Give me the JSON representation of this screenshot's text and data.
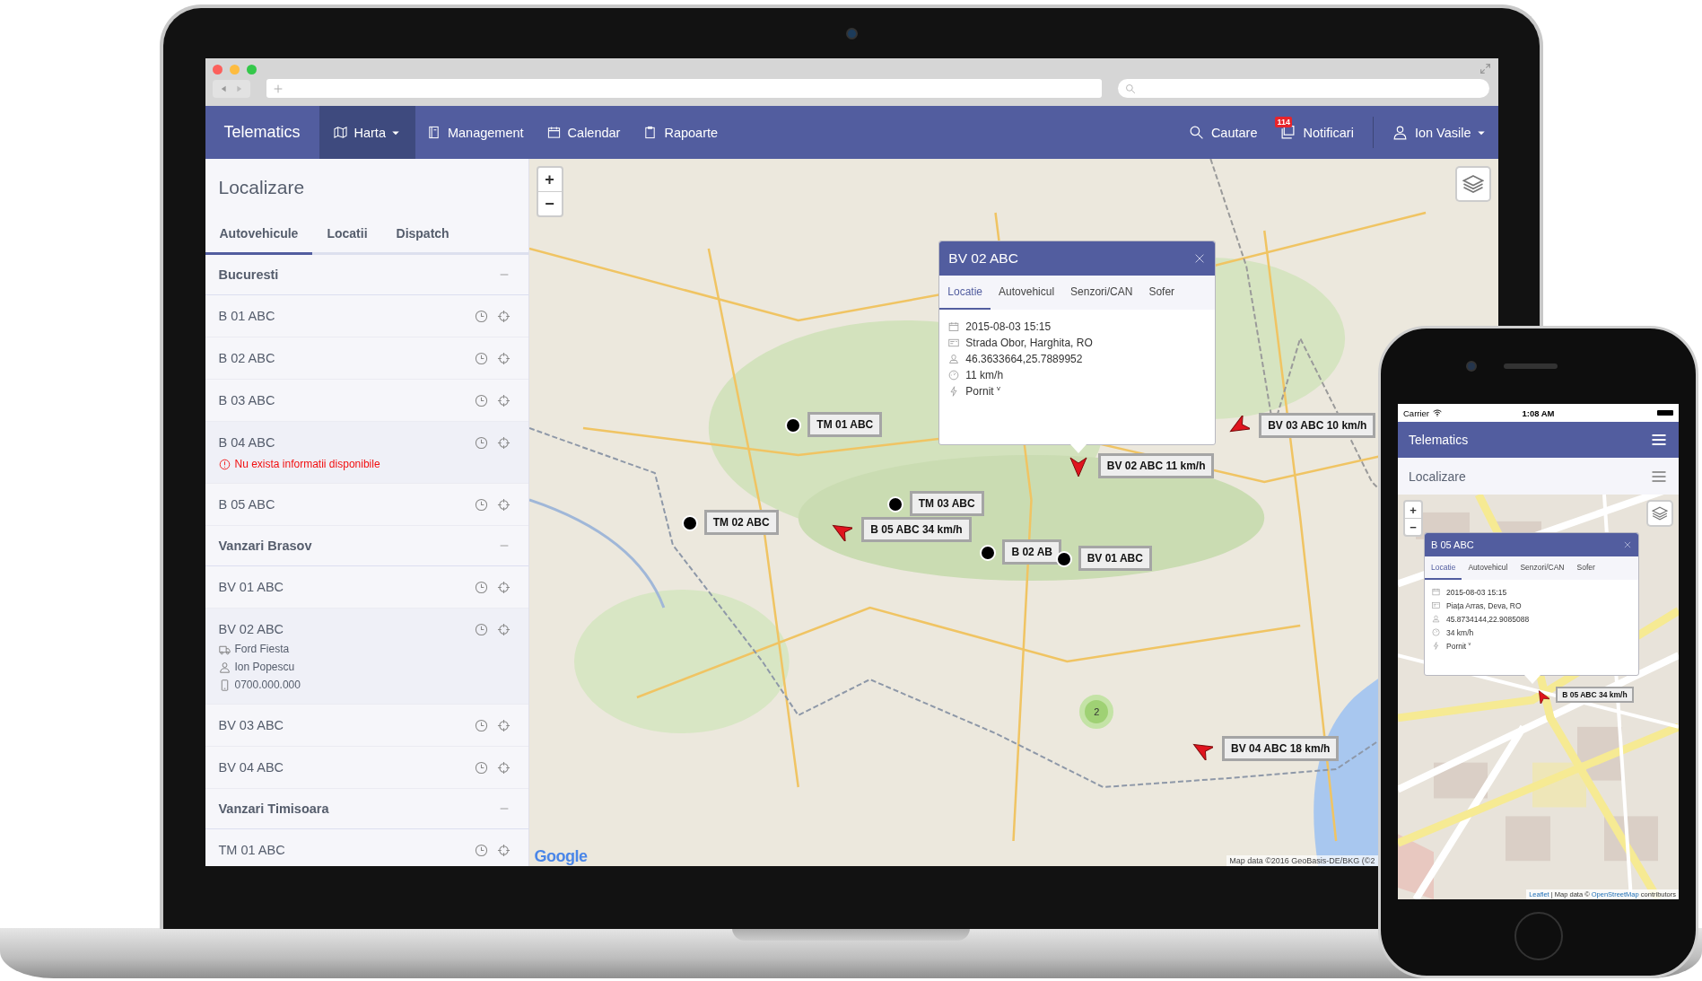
{
  "navbar": {
    "brand": "Telematics",
    "items": [
      {
        "label": "Harta",
        "dropdown": true,
        "selected": true
      },
      {
        "label": "Management",
        "dropdown": false,
        "selected": false
      },
      {
        "label": "Calendar",
        "dropdown": false,
        "selected": false
      },
      {
        "label": "Rapoarte",
        "dropdown": false,
        "selected": false
      }
    ],
    "right": [
      {
        "kind": "search",
        "label": "Cautare"
      },
      {
        "kind": "notifications",
        "label": "Notificari",
        "badge": "114"
      },
      {
        "kind": "user",
        "label": "Ion Vasile",
        "dropdown": true
      }
    ]
  },
  "sidebar": {
    "title": "Localizare",
    "tabs": [
      {
        "label": "Autovehicule",
        "selected": true
      },
      {
        "label": "Locatii",
        "selected": false
      },
      {
        "label": "Dispatch",
        "selected": false
      }
    ],
    "groups": [
      {
        "name": "Bucuresti",
        "expanded": true,
        "items": [
          {
            "plate": "B 01 ABC",
            "expanded": false
          },
          {
            "plate": "B 02 ABC",
            "expanded": false
          },
          {
            "plate": "B 03 ABC",
            "expanded": false
          },
          {
            "plate": "B 04 ABC",
            "expanded": true,
            "error": "Nu exista informatii disponibile"
          },
          {
            "plate": "B 05 ABC",
            "expanded": false
          }
        ]
      },
      {
        "name": "Vanzari Brasov",
        "expanded": true,
        "items": [
          {
            "plate": "BV 01 ABC",
            "expanded": false
          },
          {
            "plate": "BV 02 ABC",
            "expanded": true,
            "details": [
              {
                "kind": "vehicle",
                "text": "Ford Fiesta"
              },
              {
                "kind": "driver",
                "text": "Ion Popescu"
              },
              {
                "kind": "phone",
                "text": "0700.000.000"
              }
            ]
          },
          {
            "plate": "BV 03 ABC",
            "expanded": false
          },
          {
            "plate": "BV 04 ABC",
            "expanded": false
          }
        ]
      },
      {
        "name": "Vanzari Timisoara",
        "expanded": true,
        "items": [
          {
            "plate": "TM 01 ABC",
            "expanded": false
          }
        ]
      }
    ]
  },
  "map": {
    "zoom_in": "+",
    "zoom_out": "−",
    "markers": [
      {
        "kind": "dot",
        "label": "TM 01 ABC"
      },
      {
        "kind": "arrow",
        "label": "BV 03 ABC 10 km/h"
      },
      {
        "kind": "arrow",
        "label": "BV 02 ABC 11 km/h"
      },
      {
        "kind": "dot",
        "label": "TM 03 ABC"
      },
      {
        "kind": "dot",
        "label": "TM 02 ABC"
      },
      {
        "kind": "arrow",
        "label": "B 05 ABC 34 km/h"
      },
      {
        "kind": "dot",
        "label": "B 02 AB"
      },
      {
        "kind": "dot",
        "label": "BV 01 ABC"
      },
      {
        "kind": "arrow",
        "label": "BV 04 ABC 18 km/h"
      }
    ],
    "cluster": {
      "count": "2"
    },
    "popup": {
      "title": "BV 02 ABC",
      "tabs": [
        {
          "label": "Locatie",
          "selected": true
        },
        {
          "label": "Autovehicul",
          "selected": false
        },
        {
          "label": "Senzori/CAN",
          "selected": false
        },
        {
          "label": "Sofer",
          "selected": false
        }
      ],
      "details": [
        {
          "kind": "date",
          "text": "2015-08-03 15:15"
        },
        {
          "kind": "address",
          "text": "Strada Obor, Harghita, RO"
        },
        {
          "kind": "coords",
          "text": "46.3633664,25.7889952"
        },
        {
          "kind": "speed",
          "text": "11 km/h"
        },
        {
          "kind": "ignition",
          "text": "Pornit $^{v}$"
        }
      ]
    },
    "logo": "Google",
    "attribution": "Map data ©2016 GeoBasis-DE/BKG (©2"
  },
  "phone": {
    "status": {
      "carrier": "Carrier",
      "time": "1:08 AM"
    },
    "brand": "Telematics",
    "title": "Localizare",
    "map": {
      "zoom_in": "+",
      "zoom_out": "−",
      "popup": {
        "title": "B 05 ABC",
        "tabs": [
          {
            "label": "Locatie",
            "selected": true
          },
          {
            "label": "Autovehicul",
            "selected": false
          },
          {
            "label": "Senzori/CAN",
            "selected": false
          },
          {
            "label": "Sofer",
            "selected": false
          }
        ],
        "details": [
          {
            "kind": "date",
            "text": "2015-08-03 15:15"
          },
          {
            "kind": "address",
            "text": "Piața Arras, Deva, RO"
          },
          {
            "kind": "coords",
            "text": "45.8734144,22.9085088"
          },
          {
            "kind": "speed",
            "text": "34 km/h"
          },
          {
            "kind": "ignition",
            "text": "Pornit $^{v}$"
          }
        ]
      },
      "markers": [
        {
          "kind": "arrow",
          "label": "B 05 ABC 34 km/h"
        }
      ],
      "attribution": [
        {
          "kind": "link",
          "text": "Leaflet"
        },
        {
          "kind": "text",
          "text": " | Map data © "
        },
        {
          "kind": "link",
          "text": "OpenStreetMap"
        },
        {
          "kind": "text",
          "text": " contributors"
        }
      ]
    }
  }
}
